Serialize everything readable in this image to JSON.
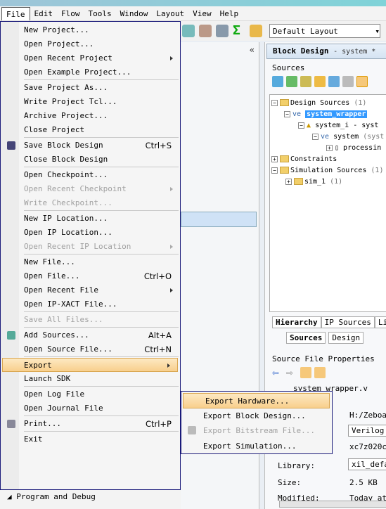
{
  "menubar": [
    "File",
    "Edit",
    "Flow",
    "Tools",
    "Window",
    "Layout",
    "View",
    "Help"
  ],
  "toolbar": {
    "layout_select": "Default Layout"
  },
  "block_design": {
    "title": "Block Design",
    "subtitle": "- system *"
  },
  "sources": {
    "label": "Sources",
    "tree": [
      {
        "text": "Design Sources",
        "extra": "(1)"
      },
      {
        "text": "system_wrapper",
        "extra": ""
      },
      {
        "text": "system_i - syst",
        "extra": ""
      },
      {
        "text": "system",
        "extra": "(syst"
      },
      {
        "text": "processin",
        "extra": ""
      },
      {
        "text": "Constraints",
        "extra": ""
      },
      {
        "text": "Simulation Sources",
        "extra": "(1)"
      },
      {
        "text": "sim_1",
        "extra": "(1)"
      }
    ],
    "tabs": [
      "Hierarchy",
      "IP Sources",
      "Li"
    ],
    "view_tabs": [
      "Sources",
      "Design"
    ]
  },
  "properties": {
    "title": "Source File Properties",
    "filename": "system_wrapper.v",
    "location": "H:/Zeboar",
    "type": "Verilog",
    "part": "xc7z020cl",
    "library_label": "Library:",
    "library": "xil_defau",
    "size_label": "Size:",
    "size": "2.5 KB",
    "modified_label": "Modified:",
    "modified": "Today at"
  },
  "file_menu": [
    {
      "label": "New Project..."
    },
    {
      "label": "Open Project..."
    },
    {
      "label": "Open Recent Project",
      "submenu": true
    },
    {
      "label": "Open Example Project..."
    },
    {
      "sep": true
    },
    {
      "label": "Save Project As..."
    },
    {
      "label": "Write Project Tcl..."
    },
    {
      "label": "Archive Project..."
    },
    {
      "label": "Close Project"
    },
    {
      "sep": true
    },
    {
      "label": "Save Block Design",
      "shortcut": "Ctrl+S",
      "icon": "save-icon"
    },
    {
      "label": "Close Block Design"
    },
    {
      "sep": true
    },
    {
      "label": "Open Checkpoint..."
    },
    {
      "label": "Open Recent Checkpoint",
      "submenu": true,
      "disabled": true
    },
    {
      "label": "Write Checkpoint...",
      "disabled": true
    },
    {
      "sep": true
    },
    {
      "label": "New IP Location..."
    },
    {
      "label": "Open IP Location..."
    },
    {
      "label": "Open Recent IP Location",
      "submenu": true,
      "disabled": true
    },
    {
      "sep": true
    },
    {
      "label": "New File..."
    },
    {
      "label": "Open File...",
      "shortcut": "Ctrl+O"
    },
    {
      "label": "Open Recent File",
      "submenu": true
    },
    {
      "label": "Open IP-XACT File..."
    },
    {
      "sep": true
    },
    {
      "label": "Save All Files...",
      "disabled": true
    },
    {
      "sep": true
    },
    {
      "label": "Add Sources...",
      "shortcut": "Alt+A",
      "icon": "add-sources-icon"
    },
    {
      "label": "Open Source File...",
      "shortcut": "Ctrl+N"
    },
    {
      "sep": true
    },
    {
      "label": "Export",
      "submenu": true,
      "active": true
    },
    {
      "label": "Launch SDK"
    },
    {
      "sep": true
    },
    {
      "label": "Open Log File"
    },
    {
      "label": "Open Journal File"
    },
    {
      "sep": true
    },
    {
      "label": "Print...",
      "shortcut": "Ctrl+P",
      "icon": "print-icon"
    },
    {
      "sep": true
    },
    {
      "label": "Exit"
    }
  ],
  "export_submenu": [
    {
      "label": "Export Hardware...",
      "active": true
    },
    {
      "label": "Export Block Design..."
    },
    {
      "label": "Export Bitstream File...",
      "disabled": true,
      "icon": "bitstream-icon"
    },
    {
      "label": "Export Simulation..."
    }
  ],
  "bottom": {
    "program_debug": "Program and Debug"
  },
  "colors": {
    "menu_highlight": "#f8cf8c",
    "selection": "#3399ff",
    "menu_border": "#1a1a7a"
  }
}
